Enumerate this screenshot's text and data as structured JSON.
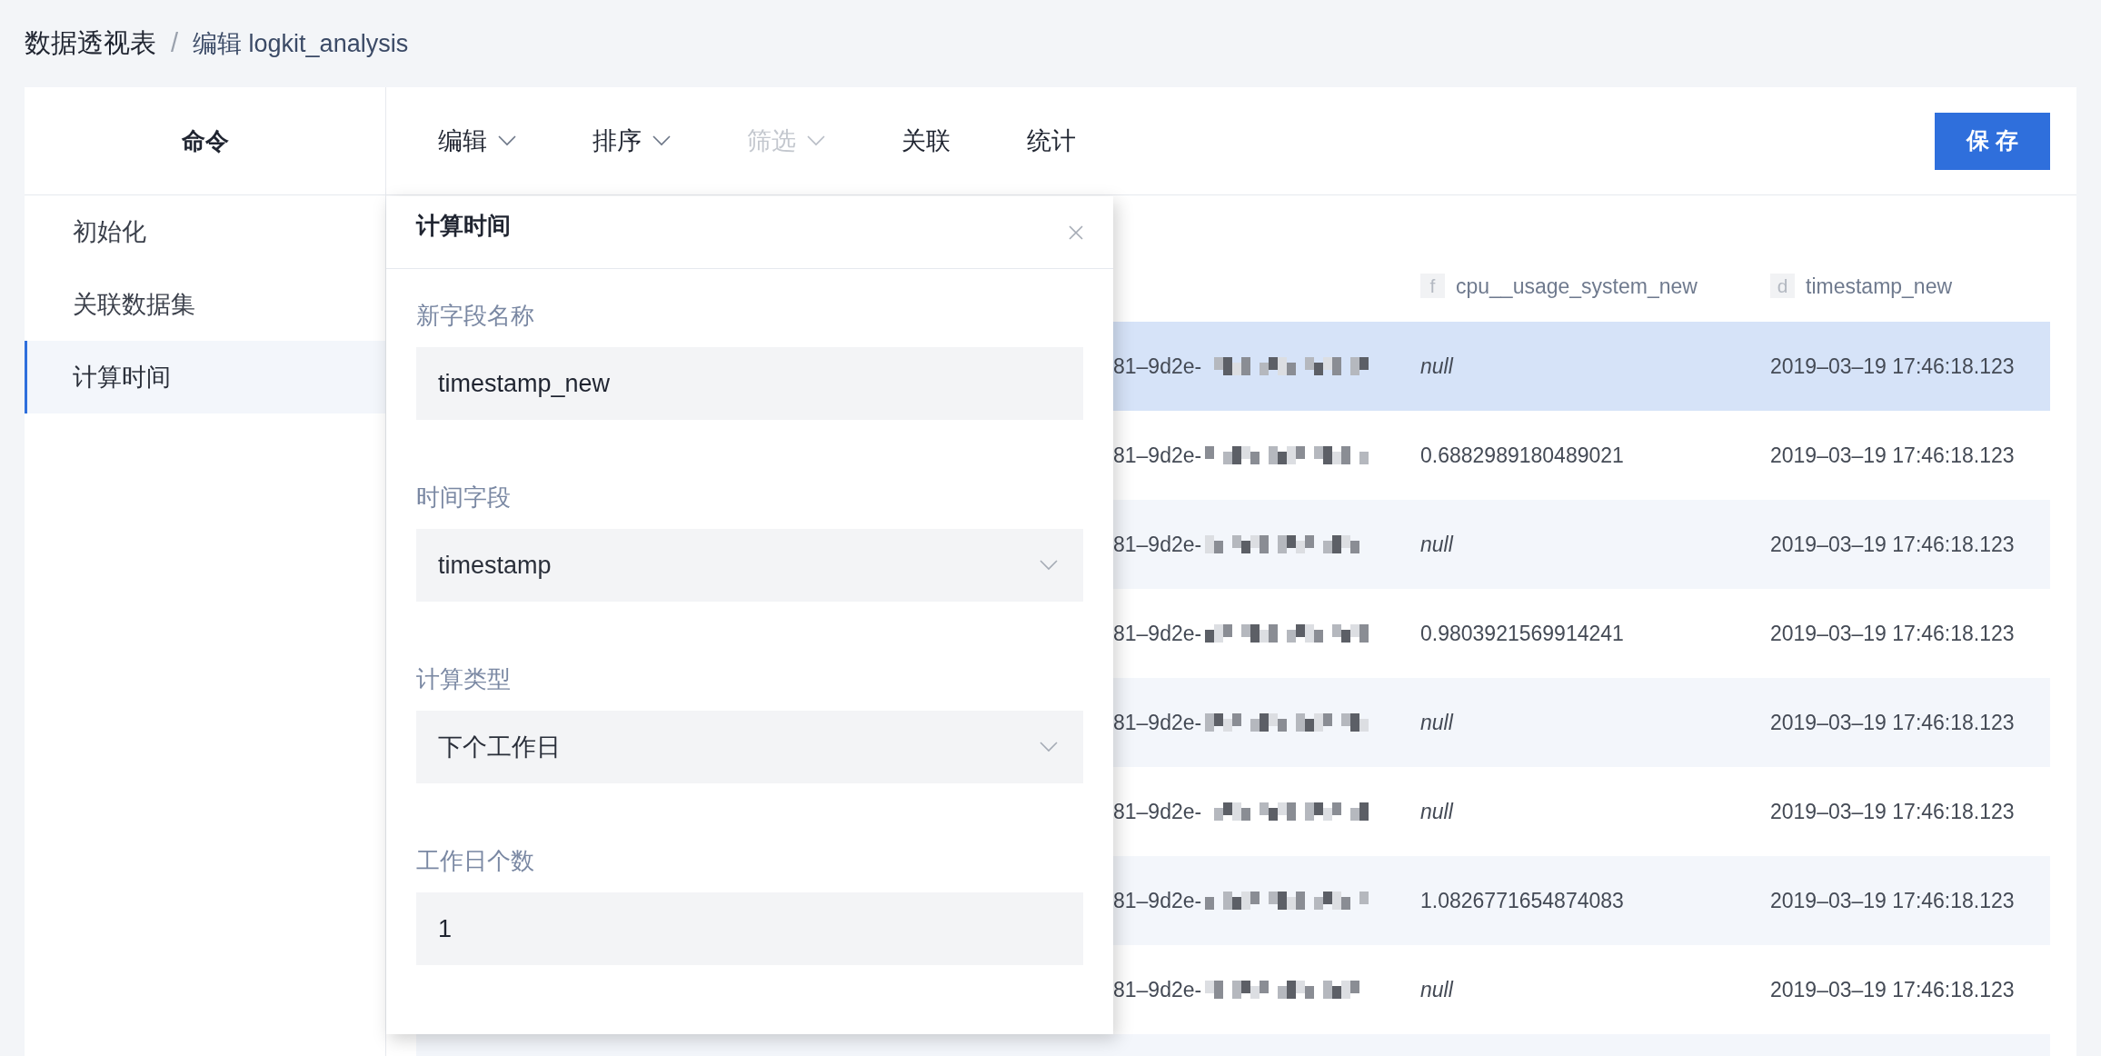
{
  "breadcrumb": {
    "root": "数据透视表",
    "separator": "/",
    "current": "编辑 logkit_analysis"
  },
  "sidebar": {
    "title": "命令",
    "items": [
      {
        "label": "初始化",
        "selected": false
      },
      {
        "label": "关联数据集",
        "selected": false
      },
      {
        "label": "计算时间",
        "selected": true
      }
    ]
  },
  "toolbar": {
    "items": [
      {
        "label": "编辑",
        "dropdown": true,
        "disabled": false
      },
      {
        "label": "排序",
        "dropdown": true,
        "disabled": false
      },
      {
        "label": "筛选",
        "dropdown": true,
        "disabled": true
      },
      {
        "label": "关联",
        "dropdown": false,
        "disabled": false
      },
      {
        "label": "统计",
        "dropdown": false,
        "disabled": false
      }
    ],
    "save": "保 存"
  },
  "table": {
    "columns": [
      {
        "type": "f",
        "name": "cpu__usage_system_new"
      },
      {
        "type": "d",
        "name": "timestamp_new"
      }
    ],
    "rows": [
      {
        "selected": true,
        "id_fragment": "81–9d2e-",
        "cells": [
          "null",
          "2019–03–19 17:46:18.123"
        ]
      },
      {
        "selected": false,
        "id_fragment": "81–9d2e-",
        "cells": [
          "0.6882989180489021",
          "2019–03–19 17:46:18.123"
        ]
      },
      {
        "selected": false,
        "id_fragment": "81–9d2e-",
        "cells": [
          "null",
          "2019–03–19 17:46:18.123"
        ]
      },
      {
        "selected": false,
        "id_fragment": "81–9d2e-",
        "cells": [
          "0.9803921569914241",
          "2019–03–19 17:46:18.123"
        ]
      },
      {
        "selected": false,
        "id_fragment": "81–9d2e-",
        "cells": [
          "null",
          "2019–03–19 17:46:18.123"
        ]
      },
      {
        "selected": false,
        "id_fragment": "81–9d2e-",
        "cells": [
          "null",
          "2019–03–19 17:46:18.123"
        ]
      },
      {
        "selected": false,
        "id_fragment": "81–9d2e-",
        "cells": [
          "1.0826771654874083",
          "2019–03–19 17:46:18.123"
        ]
      },
      {
        "selected": false,
        "id_fragment": "81–9d2e-",
        "cells": [
          "null",
          "2019–03–19 17:46:18.123"
        ]
      }
    ]
  },
  "panel": {
    "title": "计算时间",
    "fields": [
      {
        "kind": "input",
        "label": "新字段名称",
        "value": "timestamp_new"
      },
      {
        "kind": "select",
        "label": "时间字段",
        "value": "timestamp"
      },
      {
        "kind": "select",
        "label": "计算类型",
        "value": "下个工作日"
      },
      {
        "kind": "input",
        "label": "工作日个数",
        "value": "1"
      }
    ]
  }
}
